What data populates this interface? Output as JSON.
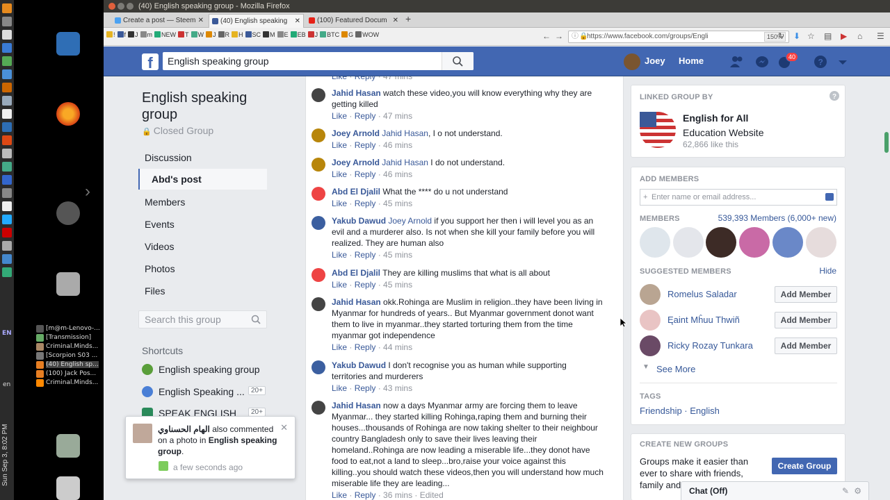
{
  "window": {
    "title": "(40) English speaking group - Mozilla Firefox"
  },
  "tabs": [
    {
      "label": "Create a post — Steem",
      "active": false
    },
    {
      "label": "(40) English speaking",
      "active": true
    },
    {
      "label": "(100) Featured Docum",
      "active": false
    }
  ],
  "bookmarks": [
    "!",
    "f",
    "J",
    "m",
    "NEW",
    "T",
    "W",
    "J",
    "R",
    "H",
    "SC",
    "M",
    "E",
    "EB",
    "J",
    "BTC",
    "G",
    "WOW"
  ],
  "url": "https://www.facebook.com/groups/Engli",
  "zoom": "150%",
  "tray": {
    "lang": "EN",
    "lang_sub": "en",
    "clock": "Sun Sep 3, 8:02 PM",
    "windows": [
      "[m@m-Lenovo-...",
      "[Transmission]",
      "Criminal.Minds...",
      "[Scorpion S03 ...",
      "(40) English sp...",
      "(100) Jack Pos...",
      "Criminal.Minds..."
    ]
  },
  "fb": {
    "search_value": "English speaking group",
    "user_name": "Joey",
    "home_label": "Home",
    "notif_count": "40"
  },
  "left": {
    "group_name": "English speaking group",
    "group_privacy": "Closed Group",
    "nav": [
      "Discussion",
      "Abd's post",
      "Members",
      "Events",
      "Videos",
      "Photos",
      "Files"
    ],
    "search_placeholder": "Search this group",
    "shortcuts_title": "Shortcuts",
    "shortcuts": [
      {
        "label": "English speaking group",
        "count": ""
      },
      {
        "label": "English Speaking ...",
        "count": "20+"
      },
      {
        "label": "SPEAK ENGLISH",
        "count": "20+"
      }
    ]
  },
  "notification": {
    "name": "الهام الحسناوي",
    "text_mid": " also commented on a photo in ",
    "group": "English speaking group",
    "tail": ".",
    "time": "a few seconds ago"
  },
  "comments": [
    {
      "name": "",
      "tag": "",
      "text": "",
      "like": "Like",
      "reply": "Reply",
      "time": "47 mins",
      "edited": ""
    },
    {
      "name": "Jahid Hasan",
      "tag": "",
      "text": " watch these video,you will know everything why they are getting killed",
      "like": "Like",
      "reply": "Reply",
      "time": "47 mins",
      "edited": ""
    },
    {
      "name": "Joey Arnold",
      "tag": "Jahid Hasan",
      "text": ", I o not understand.",
      "like": "Like",
      "reply": "Reply",
      "time": "46 mins",
      "edited": ""
    },
    {
      "name": "Joey Arnold",
      "tag": "Jahid Hasan",
      "text": " I do not understand.",
      "like": "Like",
      "reply": "Reply",
      "time": "46 mins",
      "edited": ""
    },
    {
      "name": "Abd El Djalil",
      "tag": "",
      "text": " What the **** do u not understand",
      "like": "Like",
      "reply": "Reply",
      "time": "45 mins",
      "edited": ""
    },
    {
      "name": "Yakub Dawud",
      "tag": "Joey Arnold",
      "text": " if you support her then i will level you as an evil and a murderer also. Is not when she kill your family before you will realized. They are human also",
      "like": "Like",
      "reply": "Reply",
      "time": "45 mins",
      "edited": ""
    },
    {
      "name": "Abd El Djalil",
      "tag": "",
      "text": " They are killing muslims that what is all about",
      "like": "Like",
      "reply": "Reply",
      "time": "45 mins",
      "edited": ""
    },
    {
      "name": "Jahid Hasan",
      "tag": "",
      "text": " okk.Rohinga are Muslim in religion..they have been living in Myanmar for hundreds of years.. But Myanmar government donot want them to live in myanmar..they started torturing them from the time myanmar got independence",
      "like": "Like",
      "reply": "Reply",
      "time": "44 mins",
      "edited": ""
    },
    {
      "name": "Yakub Dawud",
      "tag": "",
      "text": " I don't recognise you as human while supporting territories and murderers",
      "like": "Like",
      "reply": "Reply",
      "time": "43 mins",
      "edited": ""
    },
    {
      "name": "Jahid Hasan",
      "tag": "",
      "text": " now a days Myanmar army are forcing them to leave Myanmar... they started killing Rohinga,raping them and burning their houses...thousands of Rohinga are now taking shelter to their neighbour country Bangladesh only to save their lives leaving their homeland..Rohinga are now leading a miserable life...they donot have food to eat,not a land to sleep...bro,raise your voice against this killing..you should watch these videos,then you will understand how much miserable life they are leading...",
      "like": "Like",
      "reply": "Reply",
      "time": "36 mins",
      "edited": "Edited"
    }
  ],
  "linked": {
    "header": "LINKED GROUP BY",
    "name": "English for All",
    "category": "Education Website",
    "likes": "62,866 like this"
  },
  "add_members": {
    "header": "ADD MEMBERS",
    "placeholder": "Enter name or email address...",
    "members_header": "MEMBERS",
    "members_count": "539,393 Members (6,000+ new)",
    "suggested_header": "SUGGESTED MEMBERS",
    "hide": "Hide",
    "suggested": [
      {
        "name": "Romelus Saladar",
        "button": "Add Member"
      },
      {
        "name": "Ęaint Mĥuu Thwiñ",
        "button": "Add Member"
      },
      {
        "name": "Ricky Rozay Tunkara",
        "button": "Add Member"
      }
    ],
    "see_more": "See More",
    "tags_header": "TAGS",
    "tags": "Friendship · English"
  },
  "create": {
    "header": "CREATE NEW GROUPS",
    "text": "Groups make it easier than ever to share with friends, family and",
    "button": "Create Group"
  },
  "chat": "Chat (Off)",
  "colors": {
    "fb_blue": "#4267b2",
    "link": "#385898"
  }
}
